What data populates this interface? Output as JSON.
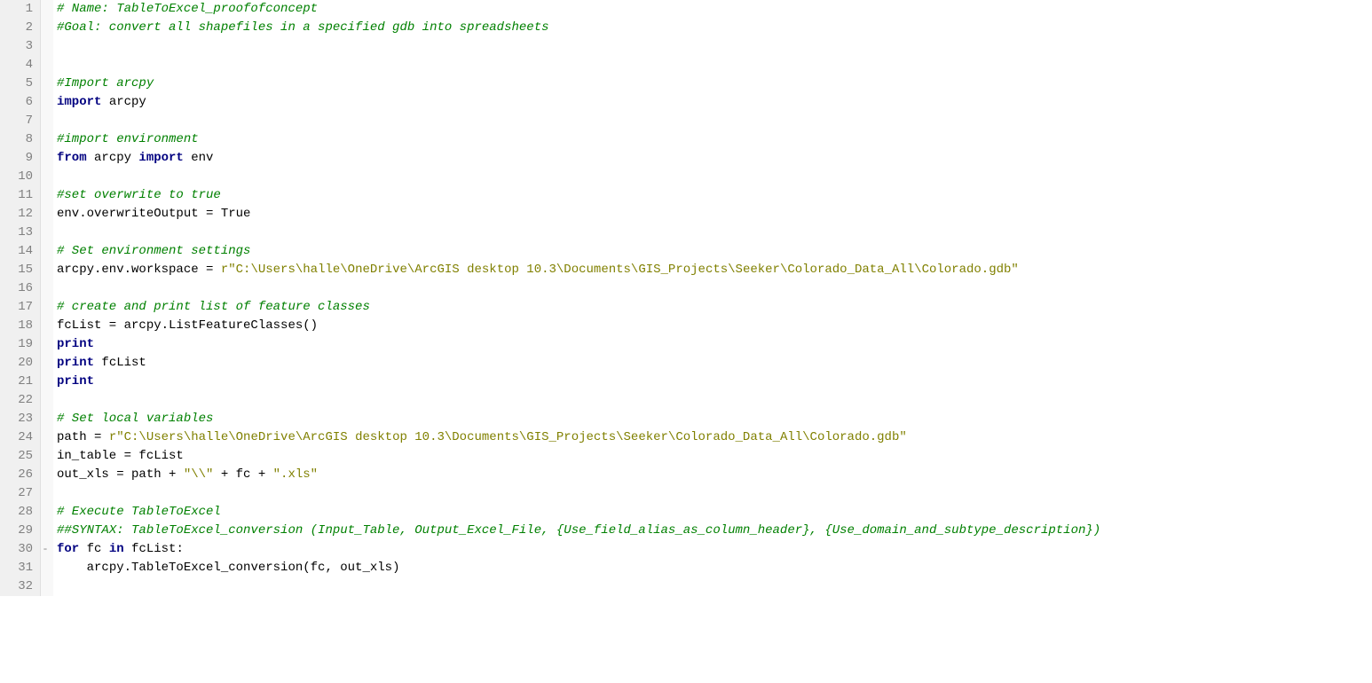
{
  "editor": {
    "lines": [
      {
        "n": 1,
        "tokens": [
          {
            "cls": "tok-comment",
            "txt": "# Name: TableToExcel_proofofconcept"
          }
        ]
      },
      {
        "n": 2,
        "tokens": [
          {
            "cls": "tok-comment",
            "txt": "#Goal: convert all shapefiles in a specified gdb into spreadsheets"
          }
        ]
      },
      {
        "n": 3,
        "tokens": []
      },
      {
        "n": 4,
        "tokens": []
      },
      {
        "n": 5,
        "tokens": [
          {
            "cls": "tok-comment",
            "txt": "#Import arcpy"
          }
        ]
      },
      {
        "n": 6,
        "tokens": [
          {
            "cls": "tok-keyword",
            "txt": "import"
          },
          {
            "cls": "tok-normal",
            "txt": " arcpy"
          }
        ]
      },
      {
        "n": 7,
        "tokens": []
      },
      {
        "n": 8,
        "tokens": [
          {
            "cls": "tok-comment",
            "txt": "#import environment"
          }
        ]
      },
      {
        "n": 9,
        "tokens": [
          {
            "cls": "tok-keyword",
            "txt": "from"
          },
          {
            "cls": "tok-normal",
            "txt": " arcpy "
          },
          {
            "cls": "tok-keyword",
            "txt": "import"
          },
          {
            "cls": "tok-normal",
            "txt": " env"
          }
        ]
      },
      {
        "n": 10,
        "tokens": []
      },
      {
        "n": 11,
        "tokens": [
          {
            "cls": "tok-comment",
            "txt": "#set overwrite to true"
          }
        ]
      },
      {
        "n": 12,
        "tokens": [
          {
            "cls": "tok-normal",
            "txt": "env.overwriteOutput = True"
          }
        ]
      },
      {
        "n": 13,
        "tokens": []
      },
      {
        "n": 14,
        "tokens": [
          {
            "cls": "tok-comment",
            "txt": "# Set environment settings"
          }
        ]
      },
      {
        "n": 15,
        "tokens": [
          {
            "cls": "tok-normal",
            "txt": "arcpy.env.workspace = "
          },
          {
            "cls": "tok-rawprefix",
            "txt": "r"
          },
          {
            "cls": "tok-string",
            "txt": "\"C:\\Users\\halle\\OneDrive\\ArcGIS desktop 10.3\\Documents\\GIS_Projects\\Seeker\\Colorado_Data_All\\Colorado.gdb\""
          }
        ]
      },
      {
        "n": 16,
        "tokens": []
      },
      {
        "n": 17,
        "tokens": [
          {
            "cls": "tok-comment",
            "txt": "# create and print list of feature classes"
          }
        ]
      },
      {
        "n": 18,
        "tokens": [
          {
            "cls": "tok-normal",
            "txt": "fcList = arcpy.ListFeatureClasses()"
          }
        ]
      },
      {
        "n": 19,
        "tokens": [
          {
            "cls": "tok-keyword",
            "txt": "print"
          }
        ]
      },
      {
        "n": 20,
        "tokens": [
          {
            "cls": "tok-keyword",
            "txt": "print"
          },
          {
            "cls": "tok-normal",
            "txt": " fcList"
          }
        ]
      },
      {
        "n": 21,
        "tokens": [
          {
            "cls": "tok-keyword",
            "txt": "print"
          }
        ]
      },
      {
        "n": 22,
        "tokens": []
      },
      {
        "n": 23,
        "tokens": [
          {
            "cls": "tok-comment",
            "txt": "# Set local variables"
          }
        ]
      },
      {
        "n": 24,
        "tokens": [
          {
            "cls": "tok-normal",
            "txt": "path = "
          },
          {
            "cls": "tok-rawprefix",
            "txt": "r"
          },
          {
            "cls": "tok-string",
            "txt": "\"C:\\Users\\halle\\OneDrive\\ArcGIS desktop 10.3\\Documents\\GIS_Projects\\Seeker\\Colorado_Data_All\\Colorado.gdb\""
          }
        ]
      },
      {
        "n": 25,
        "tokens": [
          {
            "cls": "tok-normal",
            "txt": "in_table = fcList"
          }
        ]
      },
      {
        "n": 26,
        "tokens": [
          {
            "cls": "tok-normal",
            "txt": "out_xls = path + "
          },
          {
            "cls": "tok-string",
            "txt": "\"\\\\\""
          },
          {
            "cls": "tok-normal",
            "txt": " + fc + "
          },
          {
            "cls": "tok-string",
            "txt": "\".xls\""
          }
        ]
      },
      {
        "n": 27,
        "tokens": []
      },
      {
        "n": 28,
        "tokens": [
          {
            "cls": "tok-comment",
            "txt": "# Execute TableToExcel"
          }
        ]
      },
      {
        "n": 29,
        "tokens": [
          {
            "cls": "tok-comment",
            "txt": "##SYNTAX: TableToExcel_conversion (Input_Table, Output_Excel_File, {Use_field_alias_as_column_header}, {Use_domain_and_subtype_description})"
          }
        ]
      },
      {
        "n": 30,
        "fold": "-",
        "tokens": [
          {
            "cls": "tok-keyword",
            "txt": "for"
          },
          {
            "cls": "tok-normal",
            "txt": " fc "
          },
          {
            "cls": "tok-keyword",
            "txt": "in"
          },
          {
            "cls": "tok-normal",
            "txt": " fcList:"
          }
        ]
      },
      {
        "n": 31,
        "indent": "    ",
        "tokens": [
          {
            "cls": "tok-normal",
            "txt": "arcpy.TableToExcel_conversion(fc, out_xls)"
          }
        ]
      },
      {
        "n": 32,
        "tokens": []
      }
    ]
  }
}
